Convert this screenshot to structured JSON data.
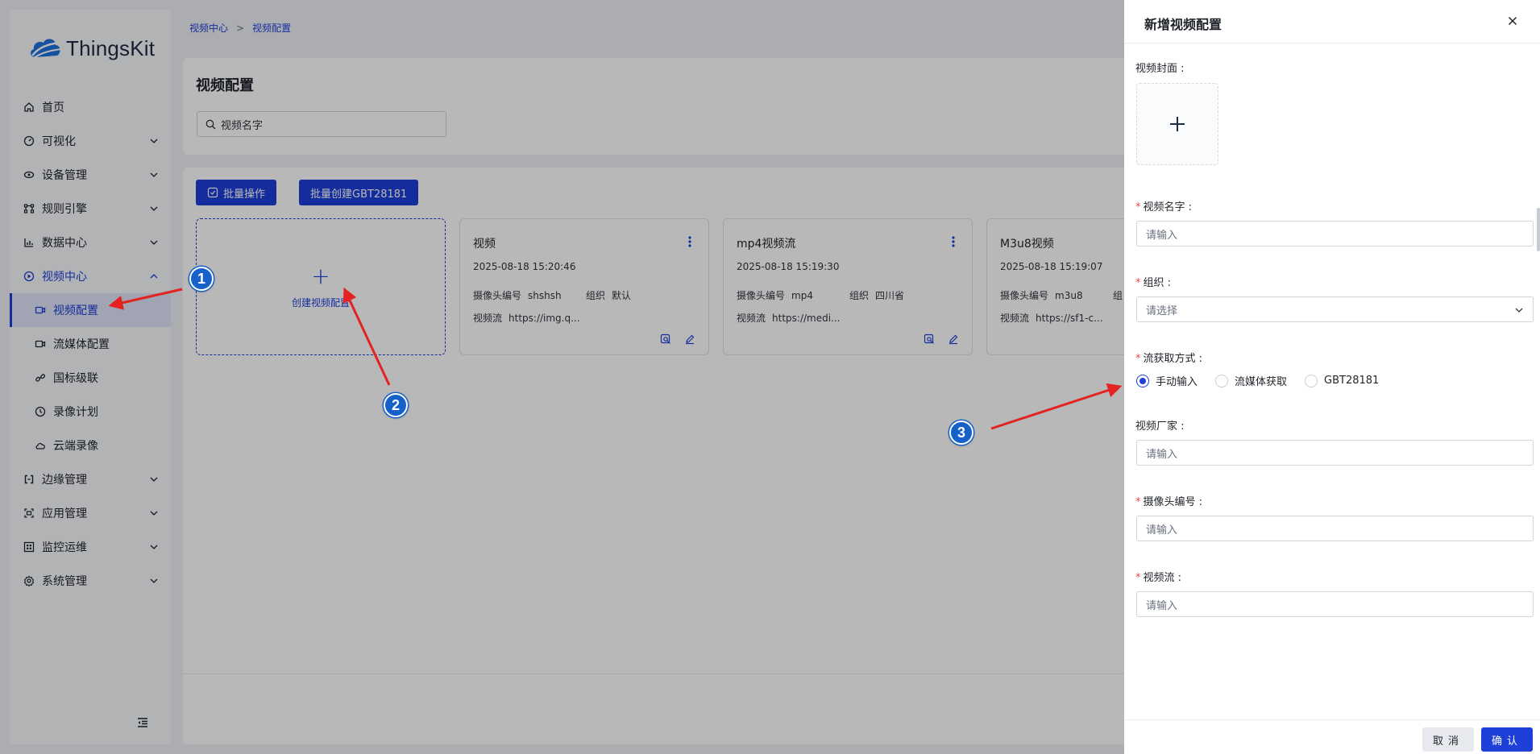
{
  "app": {
    "brand": "ThingsKit"
  },
  "sidebar": {
    "items": [
      {
        "label": "首页",
        "icon": "home-icon",
        "expandable": false
      },
      {
        "label": "可视化",
        "icon": "dashboard-icon",
        "expandable": true
      },
      {
        "label": "设备管理",
        "icon": "device-icon",
        "expandable": true
      },
      {
        "label": "规则引擎",
        "icon": "rule-engine-icon",
        "expandable": true
      },
      {
        "label": "数据中心",
        "icon": "chart-icon",
        "expandable": true
      },
      {
        "label": "视频中心",
        "icon": "video-icon",
        "expandable": true,
        "open": true
      }
    ],
    "sub_items": [
      {
        "label": "视频配置",
        "icon": "video-config-icon",
        "active": true
      },
      {
        "label": "流媒体配置",
        "icon": "stream-media-icon"
      },
      {
        "label": "国标级联",
        "icon": "link-icon"
      },
      {
        "label": "录像计划",
        "icon": "record-plan-icon"
      },
      {
        "label": "云端录像",
        "icon": "cloud-icon"
      }
    ],
    "bottom_items": [
      {
        "label": "边缘管理",
        "icon": "edge-icon"
      },
      {
        "label": "应用管理",
        "icon": "app-icon"
      },
      {
        "label": "监控运维",
        "icon": "monitor-icon"
      },
      {
        "label": "系统管理",
        "icon": "settings-icon"
      }
    ]
  },
  "breadcrumb": [
    "视频中心",
    "视频配置"
  ],
  "page": {
    "title": "视频配置",
    "search_placeholder": "视频名字",
    "batch_button": "批量操作",
    "batch_gbt_button": "批量创建GBT28181",
    "add_card_label": "创建视频配置"
  },
  "cards": [
    {
      "title": "视频",
      "time": "2025-08-18 15:20:46",
      "camera_label": "摄像头编号",
      "camera_no": "shshsh",
      "org_label": "组织",
      "org": "默认",
      "stream_label": "视频流",
      "stream": "https://img.q..."
    },
    {
      "title": "mp4视频流",
      "time": "2025-08-18 15:19:30",
      "camera_label": "摄像头编号",
      "camera_no": "mp4",
      "org_label": "组织",
      "org": "四川省",
      "stream_label": "视频流",
      "stream": "https://medi..."
    },
    {
      "title": "M3u8视频",
      "time": "2025-08-18 15:19:07",
      "camera_label": "摄像头编号",
      "camera_no": "m3u8",
      "org_label": "组",
      "org": "",
      "stream_label": "视频流",
      "stream": "https://sf1-c..."
    }
  ],
  "drawer": {
    "title": "新增视频配置",
    "cover_label": "视频封面",
    "name_label": "视频名字",
    "name_placeholder": "请输入",
    "org_label": "组织",
    "org_placeholder": "请选择",
    "stream_mode_label": "流获取方式",
    "stream_modes": [
      "手动输入",
      "流媒体获取",
      "GBT28181"
    ],
    "stream_mode_selected": 0,
    "vendor_label": "视频厂家",
    "vendor_placeholder": "请输入",
    "camera_label": "摄像头编号",
    "camera_placeholder": "请输入",
    "stream_label": "视频流",
    "stream_placeholder": "请输入",
    "cancel": "取消",
    "ok": "确认"
  },
  "annotations": [
    "1",
    "2",
    "3"
  ],
  "colors": {
    "primary": "#1e3fd8",
    "required": "#f04444",
    "arrow": "#e32222",
    "badge": "#1560c9"
  }
}
